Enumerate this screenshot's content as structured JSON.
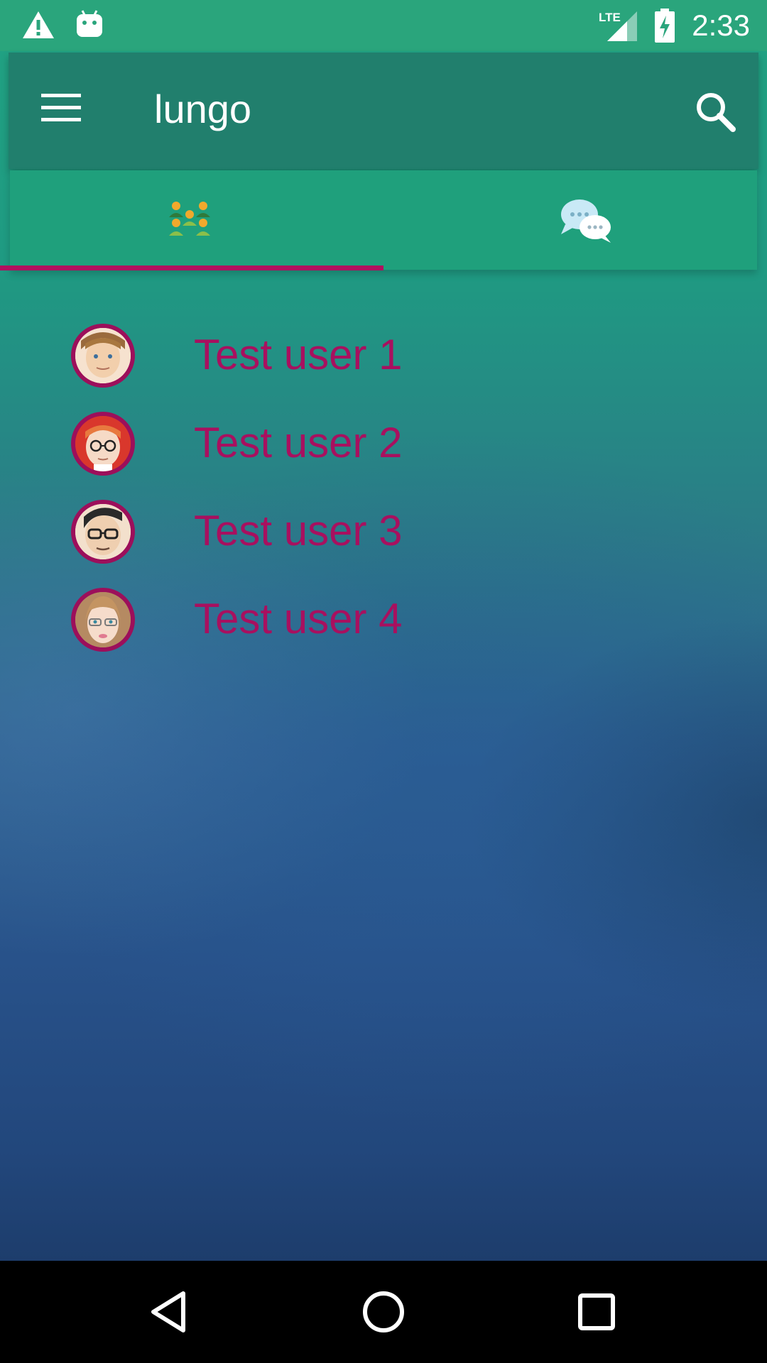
{
  "status_bar": {
    "time": "2:33",
    "icons": [
      "warning-icon",
      "android-icon",
      "lte-signal-icon",
      "battery-charging-icon"
    ],
    "network_label": "LTE"
  },
  "app_bar": {
    "title": "lungo",
    "icons": [
      "menu-icon",
      "search-icon"
    ]
  },
  "tabs": [
    {
      "name": "contacts",
      "icon": "group-people-icon",
      "selected": true
    },
    {
      "name": "chats",
      "icon": "chat-bubbles-icon",
      "selected": false
    }
  ],
  "users": [
    {
      "name": "Test user 1",
      "avatar": "man-blond-avatar"
    },
    {
      "name": "Test user 2",
      "avatar": "man-red-hair-glasses-avatar"
    },
    {
      "name": "Test user 3",
      "avatar": "man-dark-hair-glasses-avatar"
    },
    {
      "name": "Test user 4",
      "avatar": "woman-glasses-avatar"
    }
  ],
  "colors": {
    "accent": "#b0105f",
    "status_bar": "#2aa57c",
    "app_bar": "#217f6d",
    "tab_bar": "#1fa07c",
    "user_name": "#a8105f"
  },
  "nav_bar": {
    "icons": [
      "back-icon",
      "home-icon",
      "recents-icon"
    ]
  }
}
